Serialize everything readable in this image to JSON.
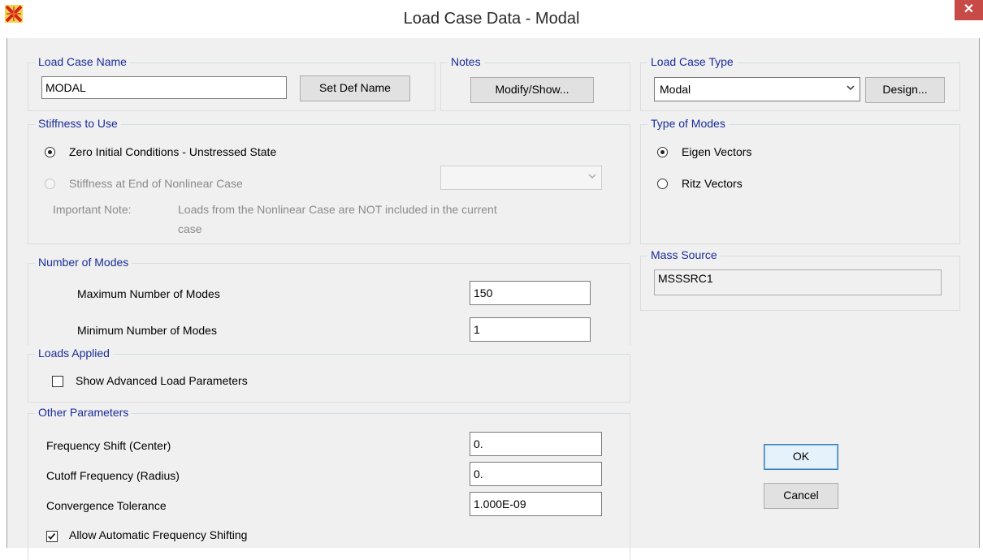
{
  "window": {
    "title": "Load Case Data - Modal",
    "close_glyph": "✕"
  },
  "load_case_name": {
    "legend": "Load Case Name",
    "value": "MODAL",
    "set_def_name_label": "Set Def Name"
  },
  "notes": {
    "legend": "Notes",
    "button_label": "Modify/Show..."
  },
  "load_case_type": {
    "legend": "Load Case Type",
    "selected": "Modal",
    "design_label": "Design..."
  },
  "stiffness": {
    "legend": "Stiffness to Use",
    "option_zero": "Zero Initial Conditions - Unstressed State",
    "option_nonlinear": "Stiffness at End of Nonlinear Case",
    "note_label": "Important Note:",
    "note_line1": "Loads from the Nonlinear Case are NOT included in the current",
    "note_line2": "case",
    "selected": "zero"
  },
  "type_of_modes": {
    "legend": "Type of Modes",
    "option_eigen": "Eigen Vectors",
    "option_ritz": "Ritz Vectors",
    "selected": "eigen"
  },
  "mass_source": {
    "legend": "Mass Source",
    "value": "MSSSRC1"
  },
  "number_of_modes": {
    "legend": "Number of Modes",
    "max_label": "Maximum Number of Modes",
    "max_value": "150",
    "min_label": "Minimum Number of Modes",
    "min_value": "1"
  },
  "loads_applied": {
    "legend": "Loads Applied",
    "show_advanced_label": "Show Advanced Load Parameters",
    "show_advanced_checked": false
  },
  "other_parameters": {
    "legend": "Other Parameters",
    "freq_shift_label": "Frequency Shift (Center)",
    "freq_shift_value": "0.",
    "cutoff_label": "Cutoff Frequency (Radius)",
    "cutoff_value": "0.",
    "tolerance_label": "Convergence Tolerance",
    "tolerance_value": "1.000E-09",
    "auto_shift_label": "Allow Automatic Frequency Shifting",
    "auto_shift_checked": true
  },
  "actions": {
    "ok_label": "OK",
    "cancel_label": "Cancel"
  },
  "icons": {
    "app": "sap2000-icon",
    "close": "close-icon",
    "dropdown": "chevron-down-icon",
    "check": "checkmark-icon"
  },
  "colors": {
    "legend_text": "#1a2c99",
    "close_button": "#c74a46",
    "dialog_bg": "#f0f0f0"
  }
}
